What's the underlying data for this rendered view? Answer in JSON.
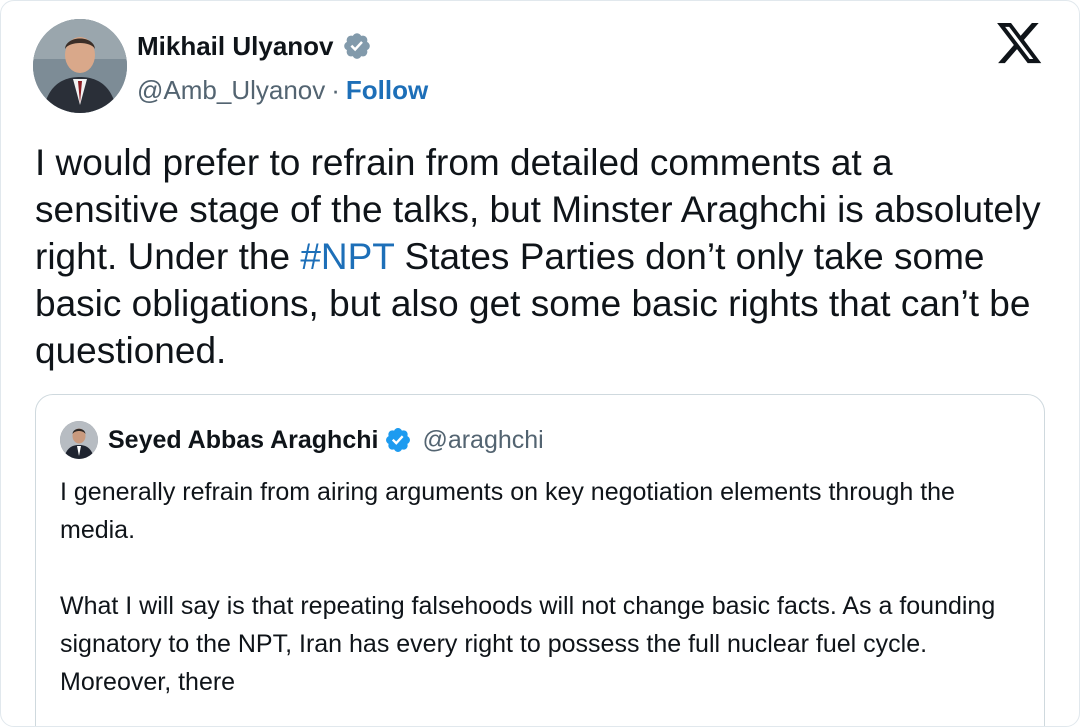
{
  "tweet": {
    "author_name": "Mikhail Ulyanov",
    "handle": "@Amb_Ulyanov",
    "separator": "·",
    "follow_label": "Follow",
    "text_before": "I would prefer to refrain from detailed comments at a sensitive stage of the talks, but Minster Araghchi is absolutely right. Under the ",
    "hashtag": "#NPT",
    "text_after": " States Parties don’t only take some basic obligations, but also get some basic rights that can’t be questioned."
  },
  "quote": {
    "author_name": "Seyed Abbas Araghchi",
    "handle": "@araghchi",
    "paragraph_1": "I generally refrain from airing arguments on key negotiation elements through the media.",
    "paragraph_2": "What I will say is that repeating falsehoods will not change basic facts. As a founding signatory to the NPT, Iran has every right to possess the full nuclear fuel cycle. Moreover, there"
  },
  "icons": {
    "verified": "verified-badge-icon",
    "brand": "x-logo-icon"
  },
  "colors": {
    "link": "#1d6fb8",
    "verified_gray": "#829aab",
    "verified_blue": "#1d9bf0",
    "secondary_text": "#536471"
  }
}
